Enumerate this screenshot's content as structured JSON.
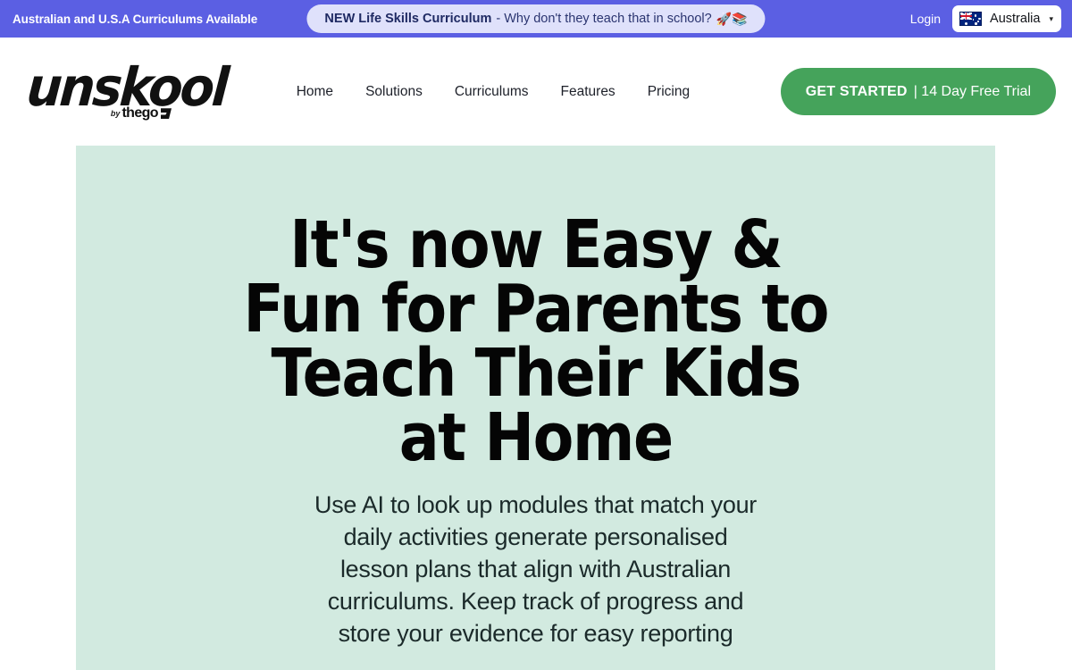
{
  "topbar": {
    "left_label": "Australian and U.S.A Curriculums Available",
    "announcement": {
      "strong": "NEW Life Skills Curriculum",
      "rest": " - Why don't they teach that in school?",
      "emoji": "🚀📚"
    },
    "login_label": "Login",
    "country": {
      "name": "Australia",
      "flag": "australia-flag",
      "chevron": "▾"
    },
    "background": "#5b5fe3",
    "pill_background": "#dfe1fb"
  },
  "header": {
    "logo": {
      "wordmark": "unskool",
      "by_label": "by",
      "brand": "thego"
    },
    "nav": [
      {
        "label": "Home"
      },
      {
        "label": "Solutions"
      },
      {
        "label": "Curriculums"
      },
      {
        "label": "Features"
      },
      {
        "label": "Pricing"
      }
    ],
    "cta": {
      "bold_label": "GET STARTED",
      "thin_label": "| 14 Day Free Trial",
      "color": "#45a35b"
    }
  },
  "hero": {
    "title": "It's now Easy &\nFun for Parents to\nTeach Their Kids\nat Home",
    "subtitle": "Use AI to look up modules that match your daily activities generate personalised lesson plans that align with Australian curriculums. Keep track of progress and store your evidence for easy reporting",
    "background": "#d2eae0"
  }
}
